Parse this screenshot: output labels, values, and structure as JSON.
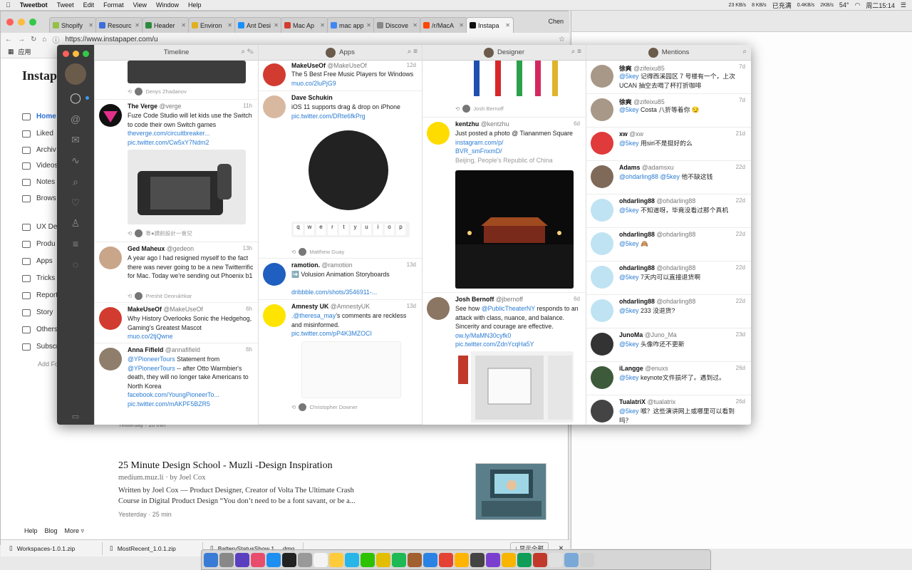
{
  "menubar": {
    "app": "Tweetbot",
    "items": [
      "Tweet",
      "Edit",
      "Format",
      "View",
      "Window",
      "Help"
    ],
    "status": {
      "net_up": "23 KB/s",
      "net_down": "8 KB/s",
      "battery": "已充满",
      "cpu_up": "0.4KB/s",
      "cpu_down": "2KB/s",
      "temp": "54°",
      "datetime": "周二15:14"
    }
  },
  "chrome": {
    "tabs": [
      {
        "label": "Shopify",
        "color": "#95bf47"
      },
      {
        "label": "Resourc",
        "color": "#3b6ddc"
      },
      {
        "label": "Header",
        "color": "#2d8a3e"
      },
      {
        "label": "Environ",
        "color": "#e0b020"
      },
      {
        "label": "Ant Desi",
        "color": "#1890ff"
      },
      {
        "label": "Mac Ap",
        "color": "#d23b2f"
      },
      {
        "label": "mac app",
        "color": "#4285f4"
      },
      {
        "label": "Discove",
        "color": "#888888"
      },
      {
        "label": "/r/MacA",
        "color": "#ff4500"
      },
      {
        "label": "Instapa",
        "color": "#111111"
      }
    ],
    "profile": "Chen",
    "url": "https://www.instapaper.com/u",
    "bookmarks_label": "应用"
  },
  "instapaper": {
    "logo": "Instap",
    "nav": [
      "Home",
      "Liked",
      "Archiv",
      "Videos",
      "Notes",
      "Brows"
    ],
    "folders": [
      "UX De",
      "Produ",
      "Apps",
      "Tricks",
      "Report",
      "Story",
      "Others",
      "Subscr"
    ],
    "add_folder": "Add Fo",
    "article": {
      "title": "25 Minute Design School - Muzli -Design Inspiration",
      "source": "medium.muz.li · by Joel Cox",
      "desc": "Written by Joel Cox — Product Designer, Creator of Volta The Ultimate Crash Course in Digital Product Design “You don’t need to be a font savant, or be a...",
      "time": "Yesterday · 25 min",
      "prev_time": "Yesterday · 10 min"
    },
    "footer": [
      "Help",
      "Blog",
      "More ▿"
    ]
  },
  "downloads": {
    "items": [
      "Workspaces-1.0.1.zip",
      "MostRecent_1.0.1.zip",
      "BatteryStatusShow 1.....dmg"
    ],
    "show_all": "显示全部"
  },
  "tweetbot": {
    "columns": [
      {
        "title": "Timeline",
        "tweets": [
          {
            "rt": "Denys Zhadanov"
          },
          {
            "name": "The Verge",
            "handle": "@verge",
            "age": "11h",
            "text": "Fuze Code Studio will let kids use the Switch to code their own Switch games",
            "link1": "theverge.com/circuitbreaker...",
            "link2": "pic.twitter.com/Cw5xY7Ndm2",
            "rt": "靠●讀創設計一會兒"
          },
          {
            "name": "Ged Maheux",
            "handle": "@gedeon",
            "age": "13h",
            "text": "A year ago I had resigned myself to the fact there was never going to be a new Twitterrific for Mac. Today we’re sending out Phoenix b1",
            "rt": "Preshit Deorukhkar"
          },
          {
            "name": "MakeUseOf",
            "handle": "@MakeUseOf",
            "age": "6h",
            "text": "Why History Overlooks Sonic the Hedgehog, Gaming’s Greatest Mascot",
            "link1": "muo.co/2tjQwne"
          },
          {
            "name": "Anna Fifield",
            "handle": "@annafifield",
            "age": "6h",
            "mention1": "@YPioneerTours",
            "text1": " Statement from",
            "mention2": "@YPioneerTours",
            "text2": " -- after Otto Warmbier's death, they will no longer take Americans to North Korea",
            "link1": "facebook.com/YoungPioneerTo...",
            "link2": "pic.twitter.com/mAKPF5BZR5"
          }
        ]
      },
      {
        "title": "Apps",
        "tweets": [
          {
            "name": "MakeUseOf",
            "handle": "@MakeUseOf",
            "age": "12d",
            "text": "The 5 Best Free Music Players for Windows",
            "link1": "muo.co/2luPjG9"
          },
          {
            "name": "Dave Schukin",
            "handle": "",
            "age": "",
            "text": "iOS 11 supports drag & drop on iPhone",
            "link1": "pic.twitter.com/DRte6fkPrg",
            "rt": "Matthew Guay",
            "keys": [
              "q",
              "w",
              "e",
              "r",
              "t",
              "y",
              "u",
              "i",
              "o",
              "p"
            ]
          },
          {
            "name": "ramotion.",
            "handle": "@ramotion",
            "age": "13d",
            "text": "➡️ Volusion Animation Storyboards",
            "link1": "dribbble.com/shots/3546911-..."
          },
          {
            "name": "Amnesty UK",
            "handle": "@AmnestyUK",
            "age": "13d",
            "mention1": ".@theresa_may",
            "text1": "’s comments are reckless and misinformed.",
            "link1": "pic.twitter.com/pP4K3MZOCI",
            "rt": "Christopher Downer"
          }
        ]
      },
      {
        "title": "Designer",
        "tweets": [
          {
            "rt": "Josh Bernoff"
          },
          {
            "name": "kentzhu",
            "handle": "@kentzhu",
            "age": "6d",
            "text": "Just posted a photo @ Tiananmen Square",
            "link1": "instagram.com/p/",
            "link2": "BVR_smFnxmD/",
            "place": "Beijing, People's Republic of China"
          },
          {
            "name": "Josh Bernoff",
            "handle": "@jbernoff",
            "age": "6d",
            "text1": "See how ",
            "mention1": "@PublicTheaterNY",
            "text2": " responds to an attack with class, nuance, and balance. Sincerity and courage are effective. ",
            "link1": "ow.ly/MaMN30cyfk0",
            "link2": "pic.twitter.com/ZdnYcqHa5Y"
          }
        ]
      },
      {
        "title": "Mentions",
        "tweets": [
          {
            "name": "徐爽",
            "handle": "@zifeixu85",
            "age": "7d",
            "mention": "@5key",
            "text": " 记得西溪园区 7 号楼有一个，上次 UCAN 抽空去喝了杯打折咖啡"
          },
          {
            "name": "徐爽",
            "handle": "@zifeixu85",
            "age": "7d",
            "mention": "@5key",
            "text": " Costa 八折等着你 😏"
          },
          {
            "name": "xw",
            "handle": "@xw",
            "age": "21d",
            "mention": "@5key",
            "text": " 用siri不是挺好的么"
          },
          {
            "name": "Adams",
            "handle": "@adamsxu",
            "age": "22d",
            "mention": "@ohdarling88 @5key",
            "text": " 他不缺这钱"
          },
          {
            "name": "ohdarling88",
            "handle": "@ohdarling88",
            "age": "22d",
            "mention": "@5key",
            "text": " 不知道呀，毕竟没看过那个真机"
          },
          {
            "name": "ohdarling88",
            "handle": "@ohdarling88",
            "age": "22d",
            "mention": "@5key",
            "text": " 🙈"
          },
          {
            "name": "ohdarling88",
            "handle": "@ohdarling88",
            "age": "22d",
            "mention": "@5key",
            "text": " 7天内可以直接退货啊"
          },
          {
            "name": "ohdarling88",
            "handle": "@ohdarling88",
            "age": "22d",
            "mention": "@5key",
            "text": " 233 没退货?"
          },
          {
            "name": "JunoMa",
            "handle": "@Juno_Ma",
            "age": "23d",
            "mention": "@5key",
            "text": " 头像咋还不更新"
          },
          {
            "name": "iLangge",
            "handle": "@enuxs",
            "age": "26d",
            "mention": "@5key",
            "text": " keynote文件损坏了。遇到过。"
          },
          {
            "name": "TualatriX",
            "handle": "@tualatrix",
            "age": "26d",
            "mention": "@5key",
            "text": " 喉？这些演讲网上或哪里可以看到吗？"
          }
        ]
      }
    ]
  },
  "colors": {
    "link": "#2a7cd3",
    "sidebar": "#3b3b3b",
    "header": "#e9e9e9"
  }
}
